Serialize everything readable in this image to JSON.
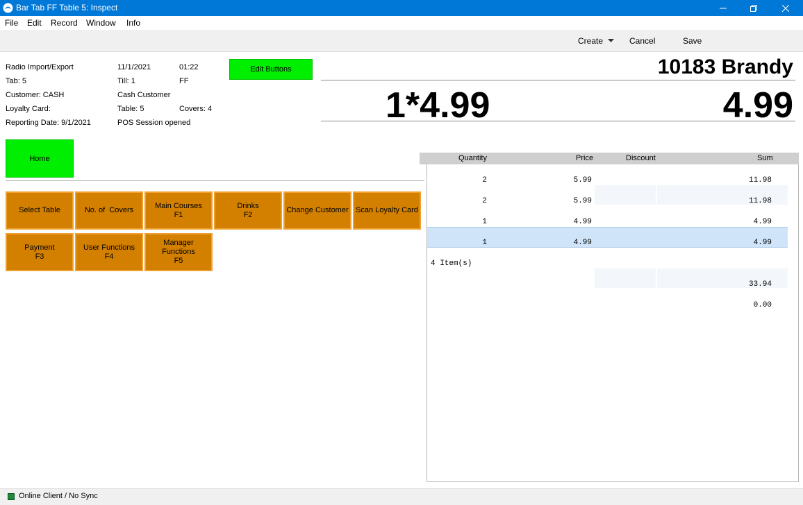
{
  "window": {
    "title": "Bar Tab FF Table 5: Inspect"
  },
  "menu": {
    "file": "File",
    "edit": "Edit",
    "record": "Record",
    "window": "Window",
    "info": "Info"
  },
  "toolbar": {
    "create": "Create",
    "cancel": "Cancel",
    "save": "Save"
  },
  "header": {
    "company": "Radio Import/Export",
    "date": "11/1/2021",
    "time": "01:22",
    "tab": "Tab: 5",
    "till": "Till: 1",
    "ff": "FF",
    "customer": "Customer: CASH",
    "customer_name": "Cash Customer",
    "loyalty": "Loyalty Card:",
    "table": "Table: 5",
    "covers": "Covers: 4",
    "reporting_date": "Reporting Date: 9/1/2021",
    "session": "POS Session opened"
  },
  "edit_buttons": "Edit Buttons",
  "display": {
    "item": "10183 Brandy",
    "calc": "1*4.99",
    "total": "4.99"
  },
  "home": "Home",
  "buttons": {
    "select_table": "Select Table",
    "no_covers": "No. of  Covers",
    "main_courses": "Main Courses",
    "main_courses_key": "F1",
    "drinks": "Drinks",
    "drinks_key": "F2",
    "change_customer": "Change Customer",
    "scan_loyalty": "Scan Loyalty Card",
    "payment": "Payment",
    "payment_key": "F3",
    "user_functions": "User Functions",
    "user_functions_key": "F4",
    "manager_functions_1": "Manager",
    "manager_functions_2": "Functions",
    "manager_functions_key": "F5"
  },
  "list": {
    "headers": {
      "quantity": "Quantity",
      "price": "Price",
      "discount": "Discount",
      "sum": "Sum"
    },
    "rows": [
      {
        "qty": "2",
        "price": "5.99",
        "sum": "11.98"
      },
      {
        "qty": "2",
        "price": "5.99",
        "sum": "11.98"
      },
      {
        "qty": "1",
        "price": "4.99",
        "sum": "4.99"
      },
      {
        "qty": "1",
        "price": "4.99",
        "sum": "4.99"
      }
    ],
    "items_count": "4 Item(s)",
    "total": "33.94",
    "extra": "0.00"
  },
  "status": {
    "text": "Online Client / No Sync"
  },
  "colors": {
    "titlebar": "#0078d7",
    "green": "#00ee00",
    "orange": "#d38000",
    "selected_row": "#cfe4f8"
  }
}
